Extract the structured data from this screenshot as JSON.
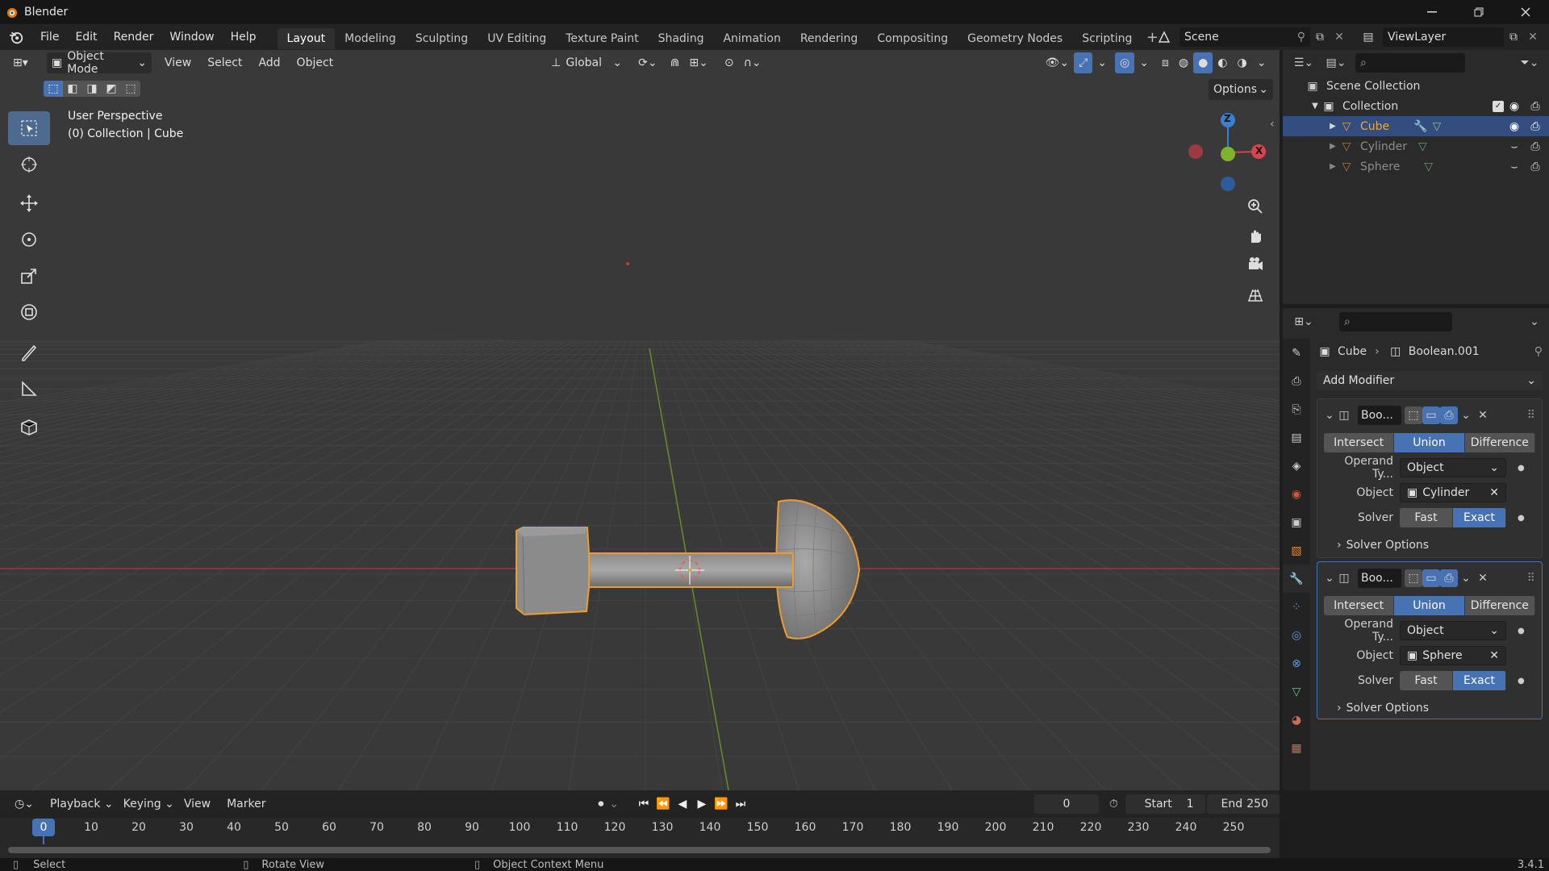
{
  "app": {
    "title": "Blender",
    "version": "3.4.1"
  },
  "menu": {
    "items": [
      "File",
      "Edit",
      "Render",
      "Window",
      "Help"
    ]
  },
  "workspaces": [
    "Layout",
    "Modeling",
    "Sculpting",
    "UV Editing",
    "Texture Paint",
    "Shading",
    "Animation",
    "Rendering",
    "Compositing",
    "Geometry Nodes",
    "Scripting"
  ],
  "active_workspace": "Layout",
  "scene": {
    "name": "Scene",
    "view_layer": "ViewLayer"
  },
  "viewport": {
    "mode": "Object Mode",
    "menus": [
      "View",
      "Select",
      "Add",
      "Object"
    ],
    "orientation": "Global",
    "options_label": "Options",
    "overlay_title": "User Perspective",
    "overlay_subtitle": "(0) Collection | Cube",
    "gizmo": {
      "z": "Z",
      "x": "X"
    }
  },
  "outliner": {
    "root": "Scene Collection",
    "collection": "Collection",
    "objects": [
      {
        "name": "Cube",
        "selected": true
      },
      {
        "name": "Cylinder",
        "selected": false
      },
      {
        "name": "Sphere",
        "selected": false
      }
    ]
  },
  "properties": {
    "breadcrumb": {
      "object": "Cube",
      "modifier": "Boolean.001"
    },
    "add_modifier": "Add Modifier",
    "modifiers": [
      {
        "name": "Boo...",
        "ops": [
          "Intersect",
          "Union",
          "Difference"
        ],
        "active_op": "Union",
        "operand_label": "Operand Ty...",
        "operand": "Object",
        "object_label": "Object",
        "object": "Cylinder",
        "solver_label": "Solver",
        "solvers": [
          "Fast",
          "Exact"
        ],
        "active_solver": "Exact",
        "solver_options": "Solver Options"
      },
      {
        "name": "Boo...",
        "ops": [
          "Intersect",
          "Union",
          "Difference"
        ],
        "active_op": "Union",
        "operand_label": "Operand Ty...",
        "operand": "Object",
        "object_label": "Object",
        "object": "Sphere",
        "solver_label": "Solver",
        "solvers": [
          "Fast",
          "Exact"
        ],
        "active_solver": "Exact",
        "solver_options": "Solver Options"
      }
    ]
  },
  "timeline": {
    "menus": [
      "Playback",
      "Keying",
      "View",
      "Marker"
    ],
    "current_frame": "0",
    "start_label": "Start",
    "start": "1",
    "end_label": "End",
    "end": "250",
    "ticks": [
      "0",
      "10",
      "20",
      "30",
      "40",
      "50",
      "60",
      "70",
      "80",
      "90",
      "100",
      "110",
      "120",
      "130",
      "140",
      "150",
      "160",
      "170",
      "180",
      "190",
      "200",
      "210",
      "220",
      "230",
      "240",
      "250"
    ]
  },
  "status": {
    "select": "Select",
    "rotate": "Rotate View",
    "context": "Object Context Menu"
  },
  "colors": {
    "accent": "#4772b3",
    "selection_outline": "#f29b2b",
    "x_axis": "#d8434e",
    "y_axis": "#7fb32b",
    "z_axis": "#3a7fd1"
  }
}
